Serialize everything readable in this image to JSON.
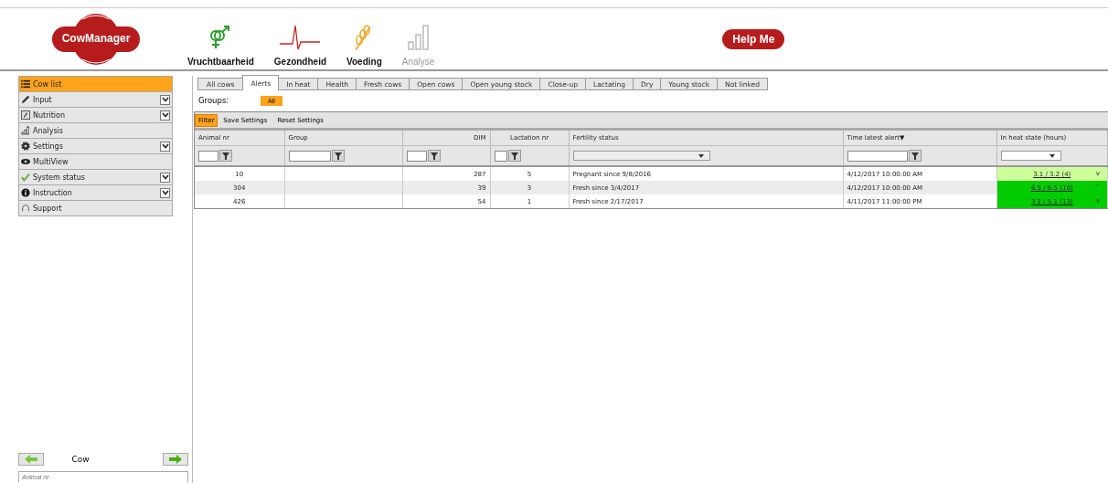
{
  "header": {
    "logo": "CowManager",
    "modules": [
      {
        "label": "Vruchtbaarheid",
        "disabled": false
      },
      {
        "label": "Gezondheid",
        "disabled": false
      },
      {
        "label": "Voeding",
        "disabled": false
      },
      {
        "label": "Analyse",
        "disabled": true
      }
    ],
    "help_button": "Help Me"
  },
  "sidebar": {
    "items": [
      {
        "label": "Cow list",
        "selected": true,
        "expandable": false
      },
      {
        "label": "Input",
        "selected": false,
        "expandable": true
      },
      {
        "label": "Nutrition",
        "selected": false,
        "expandable": true
      },
      {
        "label": "Analysis",
        "selected": false,
        "expandable": false
      },
      {
        "label": "Settings",
        "selected": false,
        "expandable": true
      },
      {
        "label": "MultiView",
        "selected": false,
        "expandable": false
      },
      {
        "label": "System status",
        "selected": false,
        "expandable": true
      },
      {
        "label": "Instruction",
        "selected": false,
        "expandable": true
      },
      {
        "label": "Support",
        "selected": false,
        "expandable": false
      }
    ],
    "navigator": {
      "title": "Cow",
      "search": {
        "placeholder": "Animal nr"
      }
    }
  },
  "tabs": [
    {
      "label": "All cows",
      "selected": false
    },
    {
      "label": "Alerts",
      "selected": true
    },
    {
      "label": "In heat",
      "selected": false
    },
    {
      "label": "Health",
      "selected": false
    },
    {
      "label": "Fresh cows",
      "selected": false
    },
    {
      "label": "Open cows",
      "selected": false
    },
    {
      "label": "Open young stock",
      "selected": false
    },
    {
      "label": "Close-up",
      "selected": false
    },
    {
      "label": "Lactating",
      "selected": false
    },
    {
      "label": "Dry",
      "selected": false
    },
    {
      "label": "Young stock",
      "selected": false
    },
    {
      "label": "Not linked",
      "selected": false
    }
  ],
  "groups": {
    "label": "Groups:",
    "options": [
      {
        "label": "All",
        "selected": true
      }
    ]
  },
  "toolbar": [
    {
      "label": "Filter",
      "selected": true
    },
    {
      "label": "Save Settings",
      "selected": false
    },
    {
      "label": "Reset Settings",
      "selected": false
    }
  ],
  "table": {
    "columns": [
      {
        "label": "Animal nr",
        "kind": "text"
      },
      {
        "label": "Group",
        "kind": "text"
      },
      {
        "label": "DIM",
        "kind": "text"
      },
      {
        "label": "Lactation nr",
        "kind": "text"
      },
      {
        "label": "Fertility status",
        "kind": "select"
      },
      {
        "label": "Time latest alert",
        "kind": "text",
        "sort": "▼"
      },
      {
        "label": "In heat state (hours)",
        "kind": "select"
      }
    ],
    "rows": [
      {
        "animal": "10",
        "dim": "287",
        "lactation": "5",
        "fertility": "Pregnant since 9/8/2016",
        "time": "4/12/2017 10:00:00 AM",
        "heat": {
          "value": "3.1 / 3.2 (4)",
          "trend": "v",
          "color": "#ccff99"
        }
      },
      {
        "animal": "304",
        "dim": "39",
        "lactation": "3",
        "fertility": "Fresh since 3/4/2017",
        "time": "4/12/2017 10:00:00 AM",
        "heat": {
          "value": "6.5 / 6.5 (10)",
          "trend": "^",
          "color": "#00cc00"
        }
      },
      {
        "animal": "426",
        "dim": "54",
        "lactation": "1",
        "fertility": "Fresh since 2/17/2017",
        "time": "4/11/2017 11:00:00 PM",
        "heat": {
          "value": "3.1 / 5.1 (13)",
          "trend": "v",
          "color": "#00cc00"
        }
      }
    ]
  }
}
